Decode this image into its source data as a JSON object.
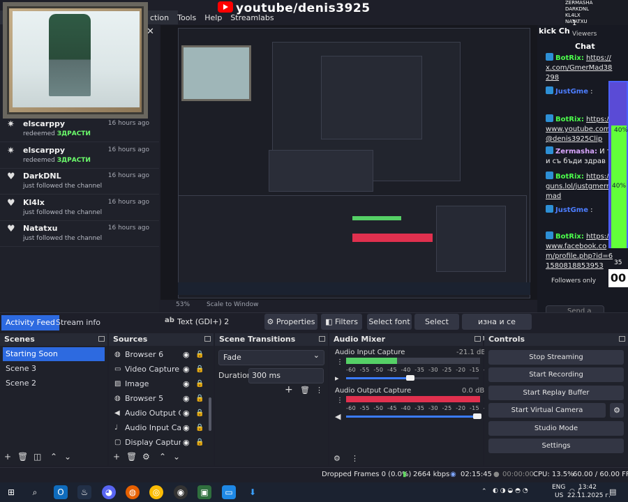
{
  "browser": {
    "header_text": "youtube/denis3925"
  },
  "menu": {
    "items": [
      "ction",
      "Tools",
      "Help",
      "Streamlabs"
    ]
  },
  "activity_feed": {
    "close_icon": "close-icon",
    "items": [
      {
        "name": "elscarppy",
        "action_prefix": "redeemed",
        "action_highlight": "ЗДРАСТИ",
        "time": "16 hours ago",
        "icon": "star-icon"
      },
      {
        "name": "elscarppy",
        "action_prefix": "redeemed",
        "action_highlight": "ЗДРАСТИ",
        "time": "16 hours ago",
        "icon": "star-icon"
      },
      {
        "name": "DarkDNL",
        "action_prefix": "just followed the channel",
        "action_highlight": "",
        "time": "16 hours ago",
        "icon": "heart-icon"
      },
      {
        "name": "Kl4lx",
        "action_prefix": "just followed the channel",
        "action_highlight": "",
        "time": "16 hours ago",
        "icon": "heart-icon"
      },
      {
        "name": "Natatxu",
        "action_prefix": "just followed the channel",
        "action_highlight": "",
        "time": "16 hours ago",
        "icon": "heart-icon"
      }
    ]
  },
  "preview_bar": {
    "zoom": "53%",
    "scale_label": "Scale to Window"
  },
  "chat": {
    "kick_title": "kick Ch",
    "top_list": [
      "ZERMASHA",
      "DARKDNL",
      "KL4LX",
      "NATATXU"
    ],
    "viewers_count": "1",
    "viewers_label": "Viewers",
    "title": "Chat",
    "messages": [
      {
        "name": "BotRix:",
        "name_color": "#4cff4c",
        "text": "https://x.com/GmerMad38298"
      },
      {
        "name": "JustGme",
        "name_color": "#4c7dff",
        "text": ":"
      },
      {
        "name": "BotRix:",
        "name_color": "#4cff4c",
        "text": "https://www.youtube.com/@denis3925Clip"
      },
      {
        "name": "Zermasha:",
        "name_color": "#d9a6ff",
        "text": "И ти съ бъди здрав"
      },
      {
        "name": "BotRix:",
        "name_color": "#4cff4c",
        "text": "https://guns.lol/justgmerrmad"
      },
      {
        "name": "JustGme",
        "name_color": "#4c7dff",
        "text": ":"
      },
      {
        "name": "BotRix:",
        "name_color": "#4cff4c",
        "text": "https://www.facebook.com/profile.php?id=61580818853953"
      }
    ],
    "followers_only": "Followers only",
    "send_placeholder": "Send a message",
    "meter_top": "40%",
    "meter_bottom": "40%",
    "meter_count": "35",
    "meter_score": "00"
  },
  "tabs": {
    "activity": "Activity Feed",
    "stream_info": "Stream info"
  },
  "selection_toolbar": {
    "source_icon": "ab",
    "source_label": "Text (GDI+) 2",
    "properties": "Properties",
    "filters": "Filters",
    "select_font": "Select font",
    "select_color": "Select color",
    "text_value": "изна и се връщам"
  },
  "scenes": {
    "title": "Scenes",
    "items": [
      "Starting Soon",
      "Scene 3",
      "Scene 2"
    ],
    "selected_index": 0
  },
  "sources": {
    "title": "Sources",
    "items": [
      {
        "label": "Browser 6",
        "icon": "globe-icon"
      },
      {
        "label": "Video Capture Dev",
        "icon": "camera-icon"
      },
      {
        "label": "Image",
        "icon": "image-icon"
      },
      {
        "label": "Browser 5",
        "icon": "globe-icon"
      },
      {
        "label": "Audio Output Cap",
        "icon": "speaker-icon"
      },
      {
        "label": "Audio Input Captu",
        "icon": "microphone-icon"
      },
      {
        "label": "Display Capture",
        "icon": "monitor-icon"
      }
    ]
  },
  "transitions": {
    "title": "Scene Transitions",
    "selected": "Fade",
    "duration_label": "Duration",
    "duration_value": "300 ms"
  },
  "mixer": {
    "title": "Audio Mixer",
    "tracks": [
      {
        "name": "Audio Input Capture",
        "db": "-21.1 dB",
        "level": 0.38,
        "volume": 0.47
      },
      {
        "name": "Audio Output Capture",
        "db": "0.0 dB",
        "level": 1.0,
        "volume": 1.0
      }
    ],
    "scale": [
      "-60",
      "-55",
      "-50",
      "-45",
      "-40",
      "-35",
      "-30",
      "-25",
      "-20",
      "-15",
      "-10",
      "-5",
      "0"
    ]
  },
  "controls": {
    "title": "Controls",
    "buttons": [
      "Stop Streaming",
      "Start Recording",
      "Start Replay Buffer",
      "Start Virtual Camera",
      "Studio Mode",
      "Settings"
    ]
  },
  "status": {
    "dropped_frames": "Dropped Frames 0 (0.0%)",
    "bitrate": "2664 kbps",
    "stream_time": "02:15:45",
    "rec_time": "00:00:00",
    "cpu": "CPU: 13.5%",
    "fps": "60.00 / 60.00 FPS"
  },
  "taskbar": {
    "lang_top": "ENG",
    "lang_bottom": "US",
    "time": "13:42",
    "date": "22.11.2025 г."
  },
  "colors": {
    "accent": "#2d6ae0",
    "green": "#4cff4c",
    "meter_red": "#e0304e"
  }
}
